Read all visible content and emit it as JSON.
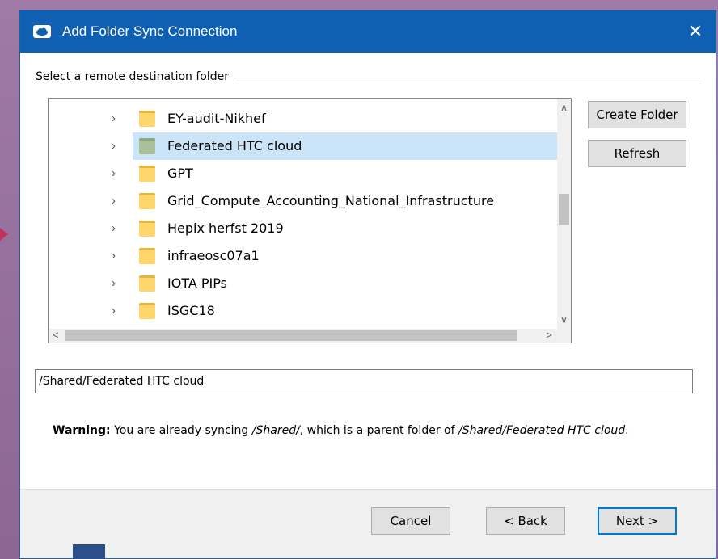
{
  "window": {
    "title": "Add Folder Sync Connection",
    "close_glyph": "✕"
  },
  "group": {
    "label": "Select a remote destination folder"
  },
  "tree": {
    "items": [
      {
        "label": "EY-audit-Nikhef",
        "selected": false
      },
      {
        "label": "Federated HTC cloud",
        "selected": true
      },
      {
        "label": "GPT",
        "selected": false
      },
      {
        "label": "Grid_Compute_Accounting_National_Infrastructure",
        "selected": false
      },
      {
        "label": "Hepix herfst 2019",
        "selected": false
      },
      {
        "label": "infraeosc07a1",
        "selected": false
      },
      {
        "label": "IOTA PIPs",
        "selected": false
      },
      {
        "label": "ISGC18",
        "selected": false
      }
    ]
  },
  "buttons": {
    "create_folder": "Create Folder",
    "refresh": "Refresh",
    "cancel": "Cancel",
    "back": "< Back",
    "next": "Next >"
  },
  "path_input": {
    "value": "/Shared/Federated HTC cloud"
  },
  "warning": {
    "prefix": "Warning:",
    "text1": " You are already syncing ",
    "path1": "/Shared/",
    "text2": ", which is a parent folder of ",
    "path2": "/Shared/Federated HTC cloud",
    "text3": "."
  },
  "icons": {
    "app": "cloud-icon",
    "folder": "folder-icon",
    "expand": "chevron-right-icon"
  },
  "colors": {
    "titlebar": "#0f5fb3",
    "selection": "#cce4f7",
    "default_button_border": "#0078d7"
  }
}
